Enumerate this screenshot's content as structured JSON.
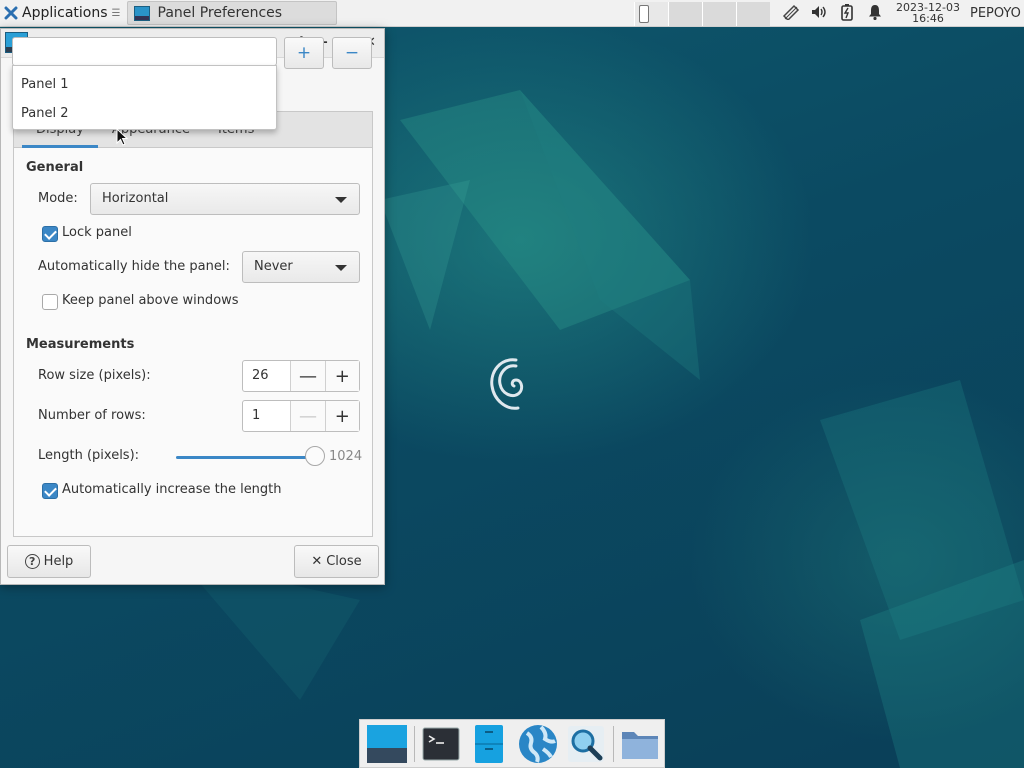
{
  "top_panel": {
    "app_menu_label": "Applications",
    "app_menu_marker": "☰",
    "task_title": "Panel Preferences",
    "clock_date": "2023-12-03",
    "clock_time": "16:46",
    "user": "PEPOYO",
    "tray_icons": [
      "network-icon",
      "volume-icon",
      "battery-icon",
      "notification-bell-icon"
    ]
  },
  "dialog": {
    "title": "Panel Preferences",
    "panel_options": [
      "Panel 1",
      "Panel 2"
    ],
    "add_label": "+",
    "remove_label": "−",
    "tabs": [
      {
        "label": "Display",
        "active": true
      },
      {
        "label": "Appearance",
        "active": false
      },
      {
        "label": "Items",
        "active": false
      }
    ],
    "general": {
      "heading": "General",
      "mode_label": "Mode:",
      "mode_value": "Horizontal",
      "lock_panel_label": "Lock panel",
      "lock_panel_checked": true,
      "autohide_label": "Automatically hide the panel:",
      "autohide_value": "Never",
      "keep_above_label": "Keep panel above windows",
      "keep_above_checked": false
    },
    "measurements": {
      "heading": "Measurements",
      "row_size_label": "Row size (pixels):",
      "row_size_value": "26",
      "rows_label": "Number of rows:",
      "rows_value": "1",
      "length_label": "Length (pixels):",
      "length_value": "1024",
      "auto_increase_label": "Automatically increase the length",
      "auto_increase_checked": true
    },
    "help_label": "Help",
    "close_label": "Close"
  },
  "dock": {
    "items": [
      "show-desktop-icon",
      "terminal-icon",
      "file-manager-icon",
      "web-browser-icon",
      "app-finder-icon",
      "folder-icon"
    ]
  }
}
